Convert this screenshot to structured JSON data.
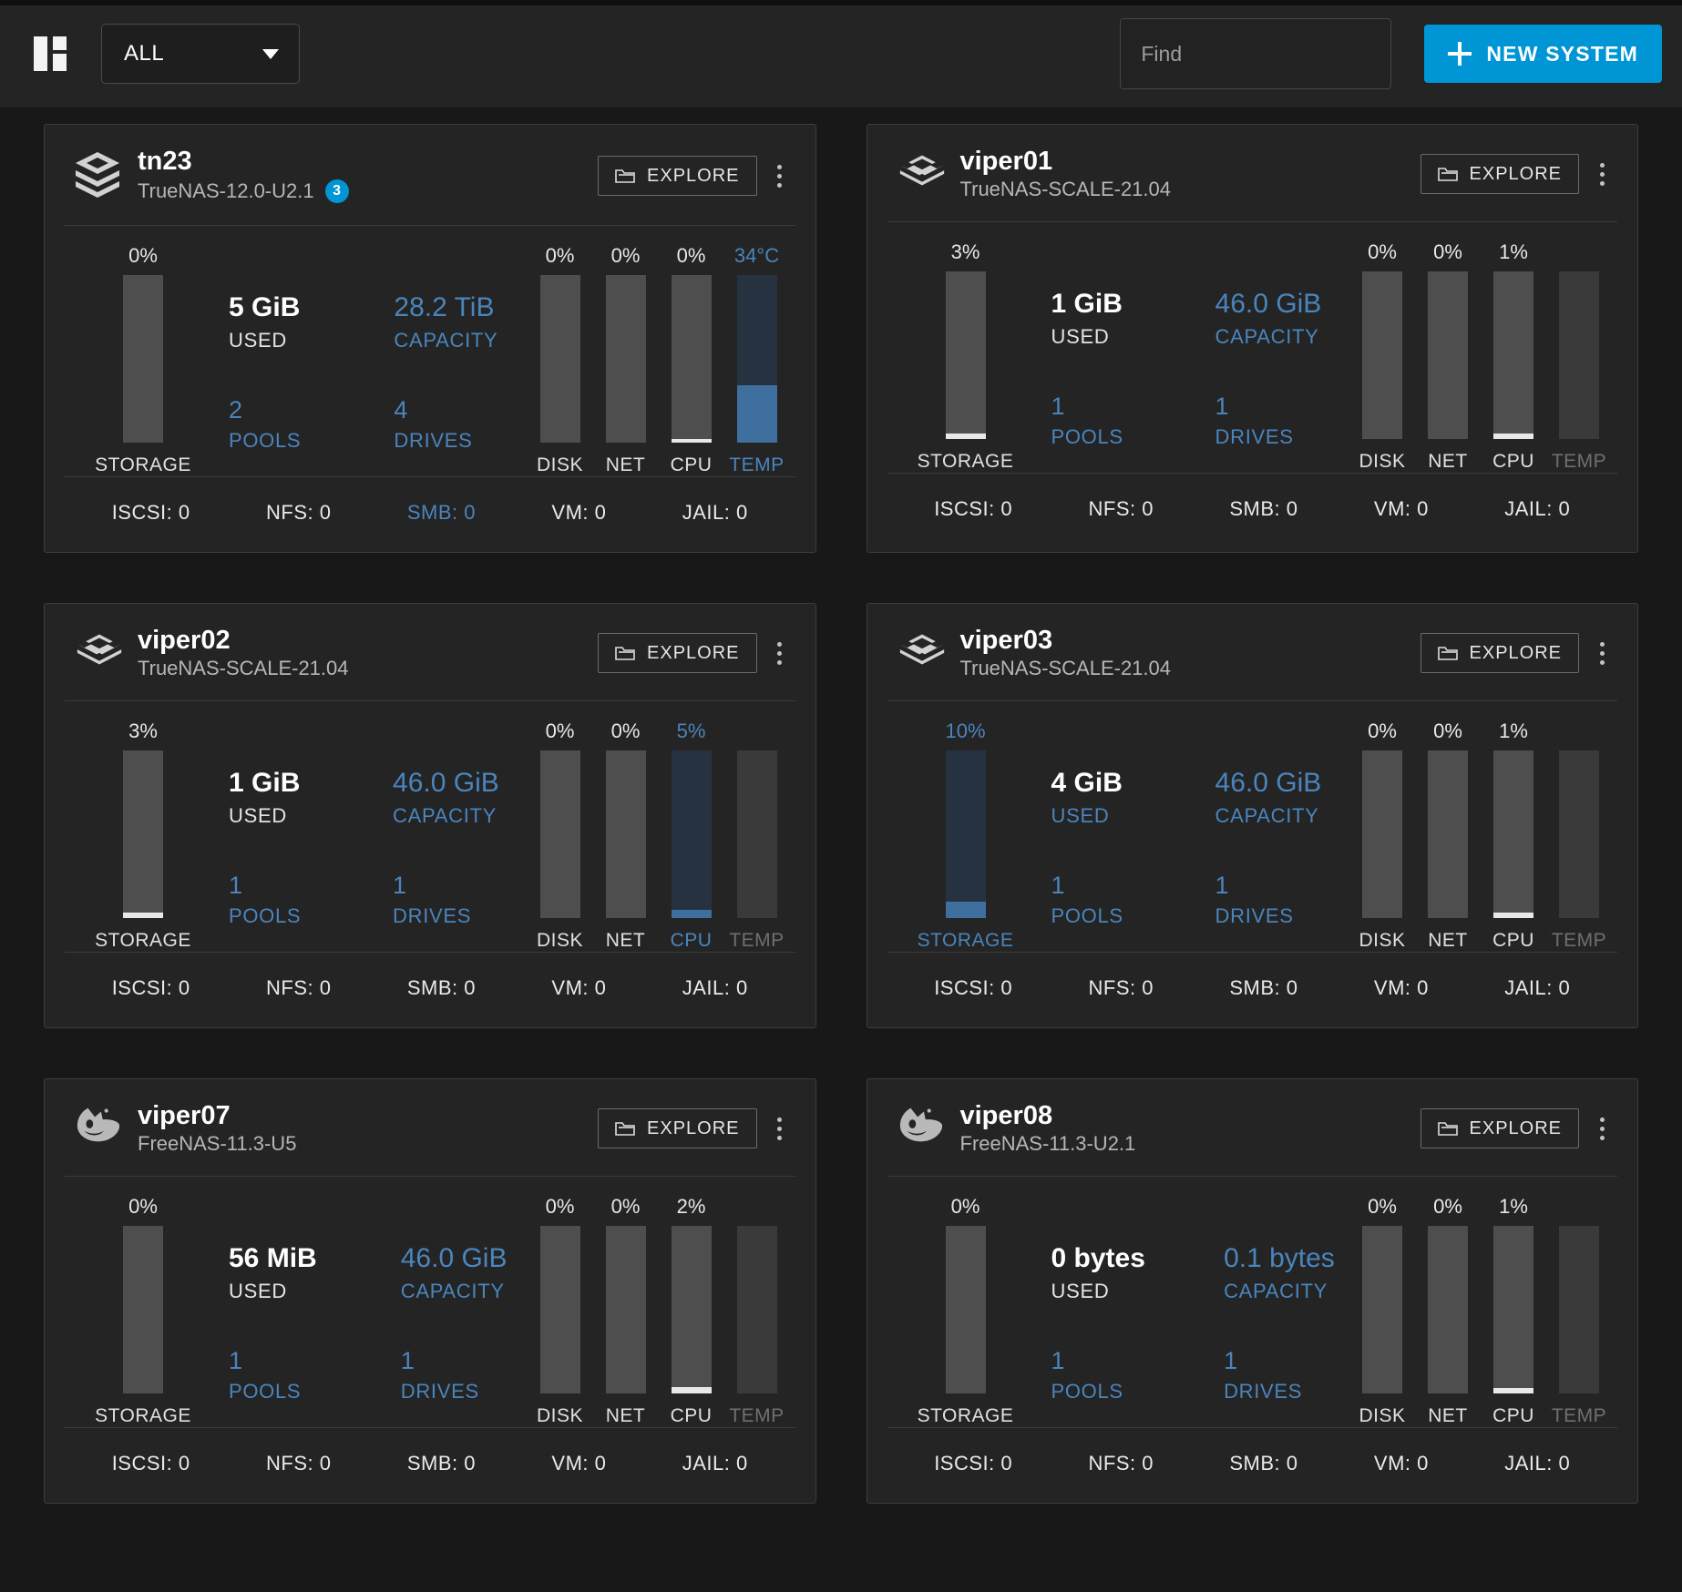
{
  "header": {
    "logo_icon": "grid-logo-icon",
    "filter_select": {
      "value": "ALL",
      "icon": "chevron-down-icon"
    },
    "search": {
      "placeholder": "Find",
      "value": ""
    },
    "new_system_button": {
      "label": "NEW SYSTEM",
      "icon": "plus-icon",
      "color": "#0095d5"
    }
  },
  "common": {
    "explore_label": "EXPLORE",
    "explore_icon": "folder-icon",
    "kebab_icon": "more-vertical-icon",
    "used_label": "USED",
    "capacity_label": "CAPACITY",
    "pools_label": "POOLS",
    "drives_label": "DRIVES",
    "storage_label": "STORAGE",
    "disk_label": "DISK",
    "net_label": "NET",
    "cpu_label": "CPU",
    "temp_label": "TEMP",
    "accent_blue": "#4a85bd",
    "brand_blue": "#0095d5"
  },
  "systems": [
    {
      "name": "tn23",
      "version": "TrueNAS-12.0-U2.1",
      "alert_badge": "3",
      "os_icon": "truenas-core-icon",
      "storage": {
        "pct_label": "0%",
        "pct": 0,
        "highlight": false
      },
      "used": "5 GiB",
      "capacity": "28.2 TiB",
      "used_highlight": false,
      "pools": "2",
      "drives": "4",
      "gauges": [
        {
          "key": "disk",
          "label": "DISK",
          "pct_label": "0%",
          "pct": 0,
          "state": "normal"
        },
        {
          "key": "net",
          "label": "NET",
          "pct_label": "0%",
          "pct": 0,
          "state": "normal"
        },
        {
          "key": "cpu",
          "label": "CPU",
          "pct_label": "0%",
          "pct": 2,
          "state": "normal"
        },
        {
          "key": "temp",
          "label": "TEMP",
          "pct_label": "34°C",
          "pct": 34,
          "state": "highlight"
        }
      ],
      "services": [
        {
          "label": "ISCSI: 0",
          "highlight": false
        },
        {
          "label": "NFS: 0",
          "highlight": false
        },
        {
          "label": "SMB: 0",
          "highlight": true
        },
        {
          "label": "VM: 0",
          "highlight": false
        },
        {
          "label": "JAIL: 0",
          "highlight": false
        }
      ]
    },
    {
      "name": "viper01",
      "version": "TrueNAS-SCALE-21.04",
      "alert_badge": "",
      "os_icon": "truenas-scale-icon",
      "storage": {
        "pct_label": "3%",
        "pct": 3,
        "highlight": false
      },
      "used": "1 GiB",
      "capacity": "46.0 GiB",
      "used_highlight": false,
      "pools": "1",
      "drives": "1",
      "gauges": [
        {
          "key": "disk",
          "label": "DISK",
          "pct_label": "0%",
          "pct": 0,
          "state": "normal"
        },
        {
          "key": "net",
          "label": "NET",
          "pct_label": "0%",
          "pct": 0,
          "state": "normal"
        },
        {
          "key": "cpu",
          "label": "CPU",
          "pct_label": "1%",
          "pct": 3,
          "state": "normal"
        },
        {
          "key": "temp",
          "label": "TEMP",
          "pct_label": "",
          "pct": 0,
          "state": "off"
        }
      ],
      "services": [
        {
          "label": "ISCSI: 0",
          "highlight": false
        },
        {
          "label": "NFS: 0",
          "highlight": false
        },
        {
          "label": "SMB: 0",
          "highlight": false
        },
        {
          "label": "VM: 0",
          "highlight": false
        },
        {
          "label": "JAIL: 0",
          "highlight": false
        }
      ]
    },
    {
      "name": "viper02",
      "version": "TrueNAS-SCALE-21.04",
      "alert_badge": "",
      "os_icon": "truenas-scale-icon",
      "storage": {
        "pct_label": "3%",
        "pct": 3,
        "highlight": false
      },
      "used": "1 GiB",
      "capacity": "46.0 GiB",
      "used_highlight": false,
      "pools": "1",
      "drives": "1",
      "gauges": [
        {
          "key": "disk",
          "label": "DISK",
          "pct_label": "0%",
          "pct": 0,
          "state": "normal"
        },
        {
          "key": "net",
          "label": "NET",
          "pct_label": "0%",
          "pct": 0,
          "state": "normal"
        },
        {
          "key": "cpu",
          "label": "CPU",
          "pct_label": "5%",
          "pct": 5,
          "state": "highlight"
        },
        {
          "key": "temp",
          "label": "TEMP",
          "pct_label": "",
          "pct": 0,
          "state": "off"
        }
      ],
      "services": [
        {
          "label": "ISCSI: 0",
          "highlight": false
        },
        {
          "label": "NFS: 0",
          "highlight": false
        },
        {
          "label": "SMB: 0",
          "highlight": false
        },
        {
          "label": "VM: 0",
          "highlight": false
        },
        {
          "label": "JAIL: 0",
          "highlight": false
        }
      ]
    },
    {
      "name": "viper03",
      "version": "TrueNAS-SCALE-21.04",
      "alert_badge": "",
      "os_icon": "truenas-scale-icon",
      "storage": {
        "pct_label": "10%",
        "pct": 10,
        "highlight": true
      },
      "used": "4 GiB",
      "capacity": "46.0 GiB",
      "used_highlight": true,
      "pools": "1",
      "drives": "1",
      "gauges": [
        {
          "key": "disk",
          "label": "DISK",
          "pct_label": "0%",
          "pct": 0,
          "state": "normal"
        },
        {
          "key": "net",
          "label": "NET",
          "pct_label": "0%",
          "pct": 0,
          "state": "normal"
        },
        {
          "key": "cpu",
          "label": "CPU",
          "pct_label": "1%",
          "pct": 3,
          "state": "normal"
        },
        {
          "key": "temp",
          "label": "TEMP",
          "pct_label": "",
          "pct": 0,
          "state": "off"
        }
      ],
      "services": [
        {
          "label": "ISCSI: 0",
          "highlight": false
        },
        {
          "label": "NFS: 0",
          "highlight": false
        },
        {
          "label": "SMB: 0",
          "highlight": false
        },
        {
          "label": "VM: 0",
          "highlight": false
        },
        {
          "label": "JAIL: 0",
          "highlight": false
        }
      ]
    },
    {
      "name": "viper07",
      "version": "FreeNAS-11.3-U5",
      "alert_badge": "",
      "os_icon": "freenas-icon",
      "storage": {
        "pct_label": "0%",
        "pct": 0,
        "highlight": false
      },
      "used": "56 MiB",
      "capacity": "46.0 GiB",
      "used_highlight": false,
      "pools": "1",
      "drives": "1",
      "gauges": [
        {
          "key": "disk",
          "label": "DISK",
          "pct_label": "0%",
          "pct": 0,
          "state": "normal"
        },
        {
          "key": "net",
          "label": "NET",
          "pct_label": "0%",
          "pct": 0,
          "state": "normal"
        },
        {
          "key": "cpu",
          "label": "CPU",
          "pct_label": "2%",
          "pct": 4,
          "state": "normal"
        },
        {
          "key": "temp",
          "label": "TEMP",
          "pct_label": "",
          "pct": 0,
          "state": "off"
        }
      ],
      "services": [
        {
          "label": "ISCSI: 0",
          "highlight": false
        },
        {
          "label": "NFS: 0",
          "highlight": false
        },
        {
          "label": "SMB: 0",
          "highlight": false
        },
        {
          "label": "VM: 0",
          "highlight": false
        },
        {
          "label": "JAIL: 0",
          "highlight": false
        }
      ]
    },
    {
      "name": "viper08",
      "version": "FreeNAS-11.3-U2.1",
      "alert_badge": "",
      "os_icon": "freenas-icon",
      "storage": {
        "pct_label": "0%",
        "pct": 0,
        "highlight": false
      },
      "used": "0 bytes",
      "capacity": "0.1 bytes",
      "used_highlight": false,
      "pools": "1",
      "drives": "1",
      "gauges": [
        {
          "key": "disk",
          "label": "DISK",
          "pct_label": "0%",
          "pct": 0,
          "state": "normal"
        },
        {
          "key": "net",
          "label": "NET",
          "pct_label": "0%",
          "pct": 0,
          "state": "normal"
        },
        {
          "key": "cpu",
          "label": "CPU",
          "pct_label": "1%",
          "pct": 3,
          "state": "normal"
        },
        {
          "key": "temp",
          "label": "TEMP",
          "pct_label": "",
          "pct": 0,
          "state": "off"
        }
      ],
      "services": [
        {
          "label": "ISCSI: 0",
          "highlight": false
        },
        {
          "label": "NFS: 0",
          "highlight": false
        },
        {
          "label": "SMB: 0",
          "highlight": false
        },
        {
          "label": "VM: 0",
          "highlight": false
        },
        {
          "label": "JAIL: 0",
          "highlight": false
        }
      ]
    }
  ]
}
